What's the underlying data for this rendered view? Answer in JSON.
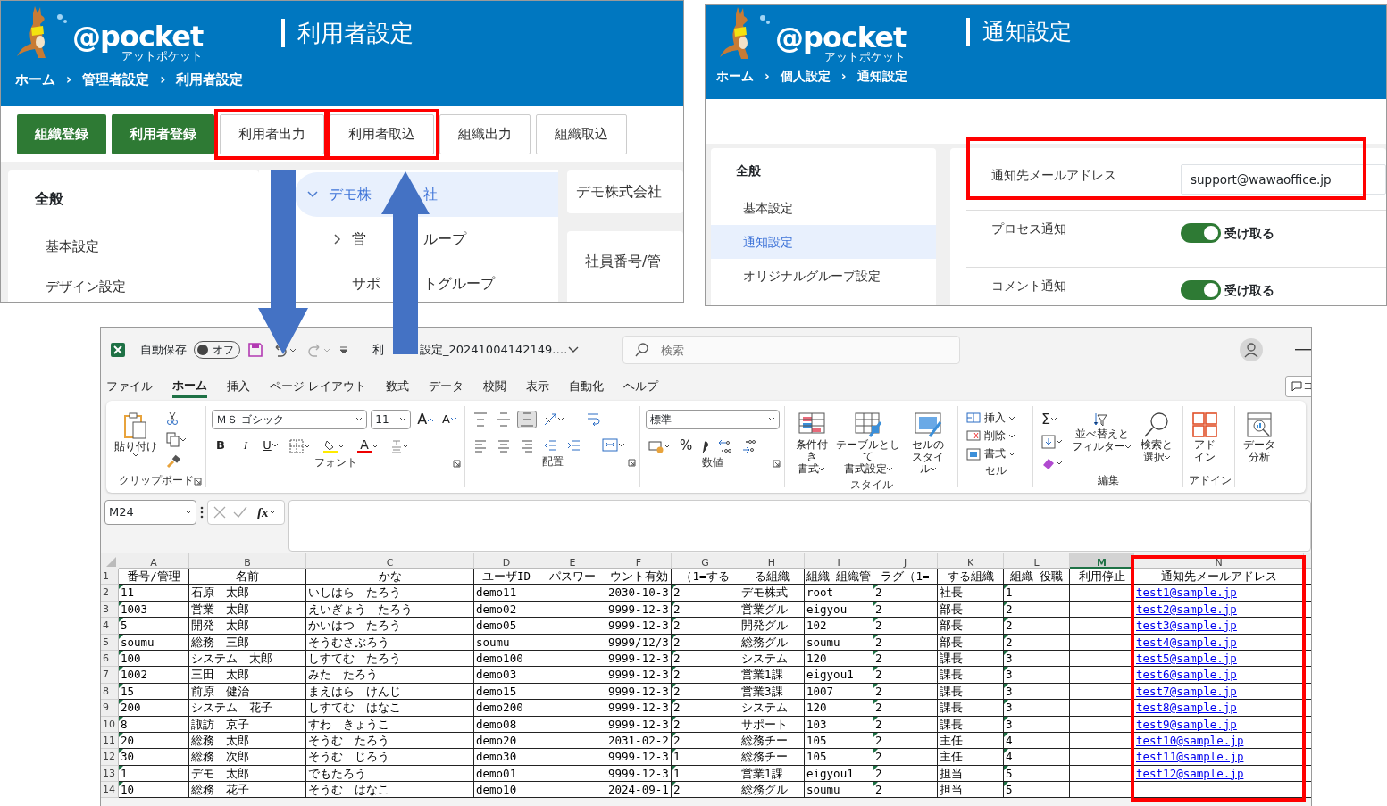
{
  "user_settings_screen": {
    "logo_text": "@pocket",
    "logo_subtext": "アットポケット",
    "page_title": "利用者設定",
    "breadcrumb": [
      "ホーム",
      "管理者設定",
      "利用者設定"
    ],
    "breadcrumb_separator": "›",
    "buttons": [
      {
        "label": "組織登録",
        "kind": "primary",
        "highlighted": false
      },
      {
        "label": "利用者登録",
        "kind": "primary",
        "highlighted": false
      },
      {
        "label": "利用者出力",
        "kind": "outline",
        "highlighted": true
      },
      {
        "label": "利用者取込",
        "kind": "outline",
        "highlighted": true
      },
      {
        "label": "組織出力",
        "kind": "outline",
        "highlighted": false
      },
      {
        "label": "組織取込",
        "kind": "outline",
        "highlighted": false
      }
    ],
    "sidebar": {
      "heading": "全般",
      "items": [
        "基本設定",
        "デザイン設定"
      ]
    },
    "tree": [
      {
        "parts": [
          "デモ株",
          "社"
        ],
        "kind": "expanded",
        "selected": true
      },
      {
        "parts": [
          "営",
          "ループ"
        ],
        "kind": "collapsed",
        "selected": false
      },
      {
        "parts": [
          "サポ",
          "トグループ"
        ],
        "kind": "leaf",
        "selected": false
      }
    ],
    "detail_title": "デモ株式会社",
    "detail_field_label": "社員番号/管"
  },
  "notification_settings_screen": {
    "logo_text": "@pocket",
    "logo_subtext": "アットポケット",
    "page_title": "通知設定",
    "breadcrumb": [
      "ホーム",
      "個人設定",
      "通知設定"
    ],
    "breadcrumb_separator": "›",
    "sidebar": {
      "heading": "全般",
      "items": [
        {
          "label": "基本設定",
          "selected": false
        },
        {
          "label": "通知設定",
          "selected": true
        },
        {
          "label": "オリジナルグループ設定",
          "selected": false
        }
      ]
    },
    "settings": [
      {
        "label": "通知先メールアドレス",
        "kind": "email",
        "value": "support@wawaoffice.jp",
        "highlighted": true
      },
      {
        "label": "プロセス通知",
        "kind": "toggle",
        "on": true,
        "text": "受け取る",
        "highlighted": false
      },
      {
        "label": "コメント通知",
        "kind": "toggle",
        "on": true,
        "text": "受け取る",
        "highlighted": false
      }
    ]
  },
  "spreadsheet_window": {
    "autosave_label": "自動保存",
    "autosave_on": false,
    "autosave_state_text": "オフ",
    "file_name_parts": [
      "利",
      "設定_20241004142149.…"
    ],
    "search_placeholder": "検索",
    "comment_button": "コ",
    "menu_tabs": [
      {
        "label": "ファイル",
        "selected": false
      },
      {
        "label": "ホーム",
        "selected": true
      },
      {
        "label": "挿入",
        "selected": false
      },
      {
        "label": "ページ レイアウト",
        "selected": false
      },
      {
        "label": "数式",
        "selected": false
      },
      {
        "label": "データ",
        "selected": false
      },
      {
        "label": "校閲",
        "selected": false
      },
      {
        "label": "表示",
        "selected": false
      },
      {
        "label": "自動化",
        "selected": false
      },
      {
        "label": "ヘルプ",
        "selected": false
      }
    ],
    "ribbon": [
      {
        "kind": "clipboard",
        "label": "クリップボード",
        "paste_label": "貼り付け",
        "launcher": true
      },
      {
        "kind": "font",
        "label": "フォント",
        "font_name": "ＭＳ ゴシック",
        "font_size": "11",
        "grow_label": "A",
        "shrink_label": "A",
        "bold_label": "B",
        "italic_label": "I",
        "underline_label": "U",
        "font_color_label": "A",
        "launcher": true
      },
      {
        "kind": "alignment",
        "label": "配置",
        "vertical_align": [
          {
            "selected": false
          },
          {
            "selected": false
          },
          {
            "selected": true
          }
        ],
        "launcher": true
      },
      {
        "kind": "number",
        "label": "数値",
        "format": "標準",
        "percent_label": "%",
        "launcher": true
      },
      {
        "kind": "styles",
        "label": "スタイル",
        "buttons": [
          [
            "条件付き",
            "書式"
          ],
          [
            "テーブルとして",
            "書式設定"
          ],
          [
            "セルの",
            "スタイル"
          ]
        ],
        "launcher": false
      },
      {
        "kind": "cells",
        "label": "セル",
        "buttons": [
          "挿入",
          "削除",
          "書式"
        ],
        "launcher": false
      },
      {
        "kind": "editing",
        "label": "編集",
        "sum_symbol": "Σ",
        "buttons": [
          [
            "並べ替えと",
            "フィルター"
          ],
          [
            "検索と",
            "選択"
          ]
        ],
        "launcher": false
      },
      {
        "kind": "addins",
        "label": "アドイン",
        "button": [
          "アド",
          "イン"
        ],
        "launcher": false
      },
      {
        "kind": "analysis",
        "button": [
          "データ",
          "分析"
        ],
        "launcher": false
      }
    ],
    "formula_bar": {
      "name_box": "M24",
      "fx_label": "fx"
    },
    "columns": [
      {
        "letter": "A",
        "selected": false,
        "flagged": true,
        "highlighted": false
      },
      {
        "letter": "B",
        "selected": false,
        "flagged": false,
        "highlighted": false
      },
      {
        "letter": "C",
        "selected": false,
        "flagged": false,
        "highlighted": false
      },
      {
        "letter": "D",
        "selected": false,
        "flagged": false,
        "highlighted": false
      },
      {
        "letter": "E",
        "selected": false,
        "flagged": false,
        "highlighted": false
      },
      {
        "letter": "F",
        "selected": false,
        "flagged": false,
        "highlighted": false
      },
      {
        "letter": "G",
        "selected": false,
        "flagged": true,
        "highlighted": false
      },
      {
        "letter": "H",
        "selected": false,
        "flagged": false,
        "highlighted": false
      },
      {
        "letter": "I",
        "selected": false,
        "flagged": false,
        "highlighted": false
      },
      {
        "letter": "J",
        "selected": false,
        "flagged": true,
        "highlighted": false
      },
      {
        "letter": "K",
        "selected": false,
        "flagged": false,
        "highlighted": false
      },
      {
        "letter": "L",
        "selected": false,
        "flagged": true,
        "highlighted": false
      },
      {
        "letter": "M",
        "selected": true,
        "flagged": false,
        "highlighted": false
      },
      {
        "letter": "N",
        "selected": false,
        "flagged": false,
        "highlighted": true
      }
    ],
    "header_row": {
      "number": "1",
      "cells": [
        "番号/管理",
        "名前",
        "かな",
        "ユーザID",
        "パスワー",
        "ウント有効",
        "（1=する",
        "る組織",
        "組織 組織管",
        "ラグ（1=",
        "する組織",
        "組織 役職",
        "利用停止",
        "通知先メールアドレス"
      ]
    },
    "rows": [
      {
        "number": "2",
        "cells": [
          "11",
          "石原　太郎",
          "いしはら　たろう",
          "demo11",
          null,
          "2030-10-3",
          "2",
          "デモ株式",
          "root",
          "2",
          "社長",
          "1",
          null
        ],
        "email": "test1@sample.jp"
      },
      {
        "number": "3",
        "cells": [
          "1003",
          "営業　太郎",
          "えいぎょう　たろう",
          "demo02",
          null,
          "9999-12-3",
          "2",
          "営業グル",
          "eigyou",
          "2",
          "部長",
          "2",
          null
        ],
        "email": "test2@sample.jp"
      },
      {
        "number": "4",
        "cells": [
          "5",
          "開発　太郎",
          "かいはつ　たろう",
          "demo05",
          null,
          "9999-12-3",
          "2",
          "開発グル",
          "102",
          "2",
          "部長",
          "2",
          null
        ],
        "email": "test3@sample.jp"
      },
      {
        "number": "5",
        "cells": [
          "soumu",
          "総務　三郎",
          "そうむさぶろう",
          "soumu",
          null,
          "9999/12/3",
          "2",
          "総務グル",
          "soumu",
          "2",
          "部長",
          "2",
          null
        ],
        "email": "test4@sample.jp"
      },
      {
        "number": "6",
        "cells": [
          "100",
          "システム　太郎",
          "しすてむ　たろう",
          "demo100",
          null,
          "9999-12-3",
          "2",
          "システム",
          "120",
          "2",
          "課長",
          "3",
          null
        ],
        "email": "test5@sample.jp"
      },
      {
        "number": "7",
        "cells": [
          "1002",
          "三田　太郎",
          "みた　たろう",
          "demo03",
          null,
          "9999-12-3",
          "2",
          "営業1課",
          "eigyou1",
          "2",
          "課長",
          "3",
          null
        ],
        "email": "test6@sample.jp"
      },
      {
        "number": "8",
        "cells": [
          "15",
          "前原　健治",
          "まえはら　けんじ",
          "demo15",
          null,
          "9999-12-3",
          "2",
          "営業3課",
          "1007",
          "2",
          "課長",
          "3",
          null
        ],
        "email": "test7@sample.jp"
      },
      {
        "number": "9",
        "cells": [
          "200",
          "システム　花子",
          "しすてむ　はなこ",
          "demo200",
          null,
          "9999-12-3",
          "2",
          "システム",
          "120",
          "2",
          "課長",
          "3",
          null
        ],
        "email": "test8@sample.jp"
      },
      {
        "number": "10",
        "cells": [
          "8",
          "諏訪　京子",
          "すわ　きょうこ",
          "demo08",
          null,
          "9999-12-3",
          "2",
          "サポート",
          "103",
          "2",
          "課長",
          "3",
          null
        ],
        "email": "test9@sample.jp"
      },
      {
        "number": "11",
        "cells": [
          "20",
          "総務　太郎",
          "そうむ　たろう",
          "demo20",
          null,
          "2031-02-2",
          "2",
          "総務チー",
          "105",
          "2",
          "主任",
          "4",
          null
        ],
        "email": "test10@sample.jp"
      },
      {
        "number": "12",
        "cells": [
          "30",
          "総務　次郎",
          "そうむ　じろう",
          "demo30",
          null,
          "9999-12-3",
          "1",
          "総務チー",
          "105",
          "2",
          "主任",
          "4",
          null
        ],
        "email": "test11@sample.jp"
      },
      {
        "number": "13",
        "cells": [
          "1",
          "デモ　太郎",
          "でもたろう",
          "demo01",
          null,
          "9999-12-3",
          "1",
          "営業1課",
          "eigyou1",
          "2",
          "担当",
          "5",
          null
        ],
        "email": "test12@sample.jp"
      },
      {
        "number": "14",
        "cells": [
          "10",
          "総務　花子",
          "そうむ　はなこ",
          "demo10",
          null,
          "2024-09-1",
          "2",
          "総務グル",
          "soumu",
          "2",
          "担当",
          "5",
          null
        ],
        "email": null
      }
    ]
  }
}
